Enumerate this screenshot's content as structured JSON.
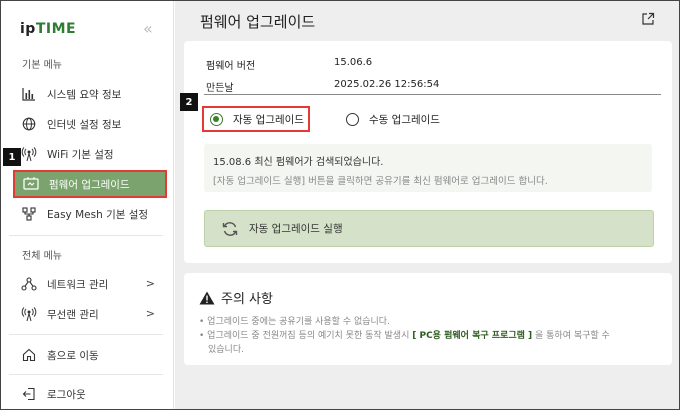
{
  "logo": {
    "ip": "ip",
    "time": "TIME"
  },
  "sidebar": {
    "collapse_icon": "double-chevron-left-icon",
    "basic_menu_label": "기본 메뉴",
    "basic_items": [
      {
        "label": "시스템 요약 정보",
        "icon": "bar-chart-icon"
      },
      {
        "label": "인터넷 설정 정보",
        "icon": "globe-icon"
      },
      {
        "label": "WiFi 기본 설정",
        "icon": "wifi-icon"
      },
      {
        "label": "펌웨어 업그레이드",
        "icon": "firmware-icon",
        "active": true
      },
      {
        "label": "Easy Mesh 기본 설정",
        "icon": "mesh-icon"
      }
    ],
    "full_menu_label": "전체 메뉴",
    "full_items": [
      {
        "label": "네트워크 관리",
        "icon": "network-icon"
      },
      {
        "label": "무선랜 관리",
        "icon": "wireless-icon"
      }
    ],
    "home_label": "홈으로 이동",
    "logout_label": "로그아웃"
  },
  "badges": {
    "b1": "1",
    "b2": "2"
  },
  "main": {
    "title": "펌웨어 업그레이드",
    "firmware_version_label": "펌웨어 버전",
    "firmware_version_value": "15.06.6",
    "build_date_label": "만든날",
    "build_date_value": "2025.02.26 12:56:54",
    "auto_upgrade_label": "자동 업그레이드",
    "manual_upgrade_label": "수동 업그레이드",
    "notice_line1": "15.08.6 최신 펌웨어가 검색되었습니다.",
    "notice_line2": "[자동 업그레이드 실행] 버튼을 클릭하면 공유기를 최신 펌웨어로 업그레이드 합니다.",
    "run_button_label": "자동 업그레이드 실행",
    "caution_title": "주의 사항",
    "caution_line1": "업그레이드 중에는 공유기를 사용할 수 없습니다.",
    "caution_line2a": "업그레이드 중 전원꺼짐 등의 예기치 못한 동작 발생시",
    "caution_line2_highlight": "[ PC용 펌웨어 복구 프로그램 ]",
    "caution_line2b": "을 통하여 복구할 수",
    "caution_line2c": "있습니다."
  },
  "colors": {
    "accent": "#7ba36e",
    "highlight_border": "#e53935",
    "button_bg": "#d5e2c9"
  }
}
